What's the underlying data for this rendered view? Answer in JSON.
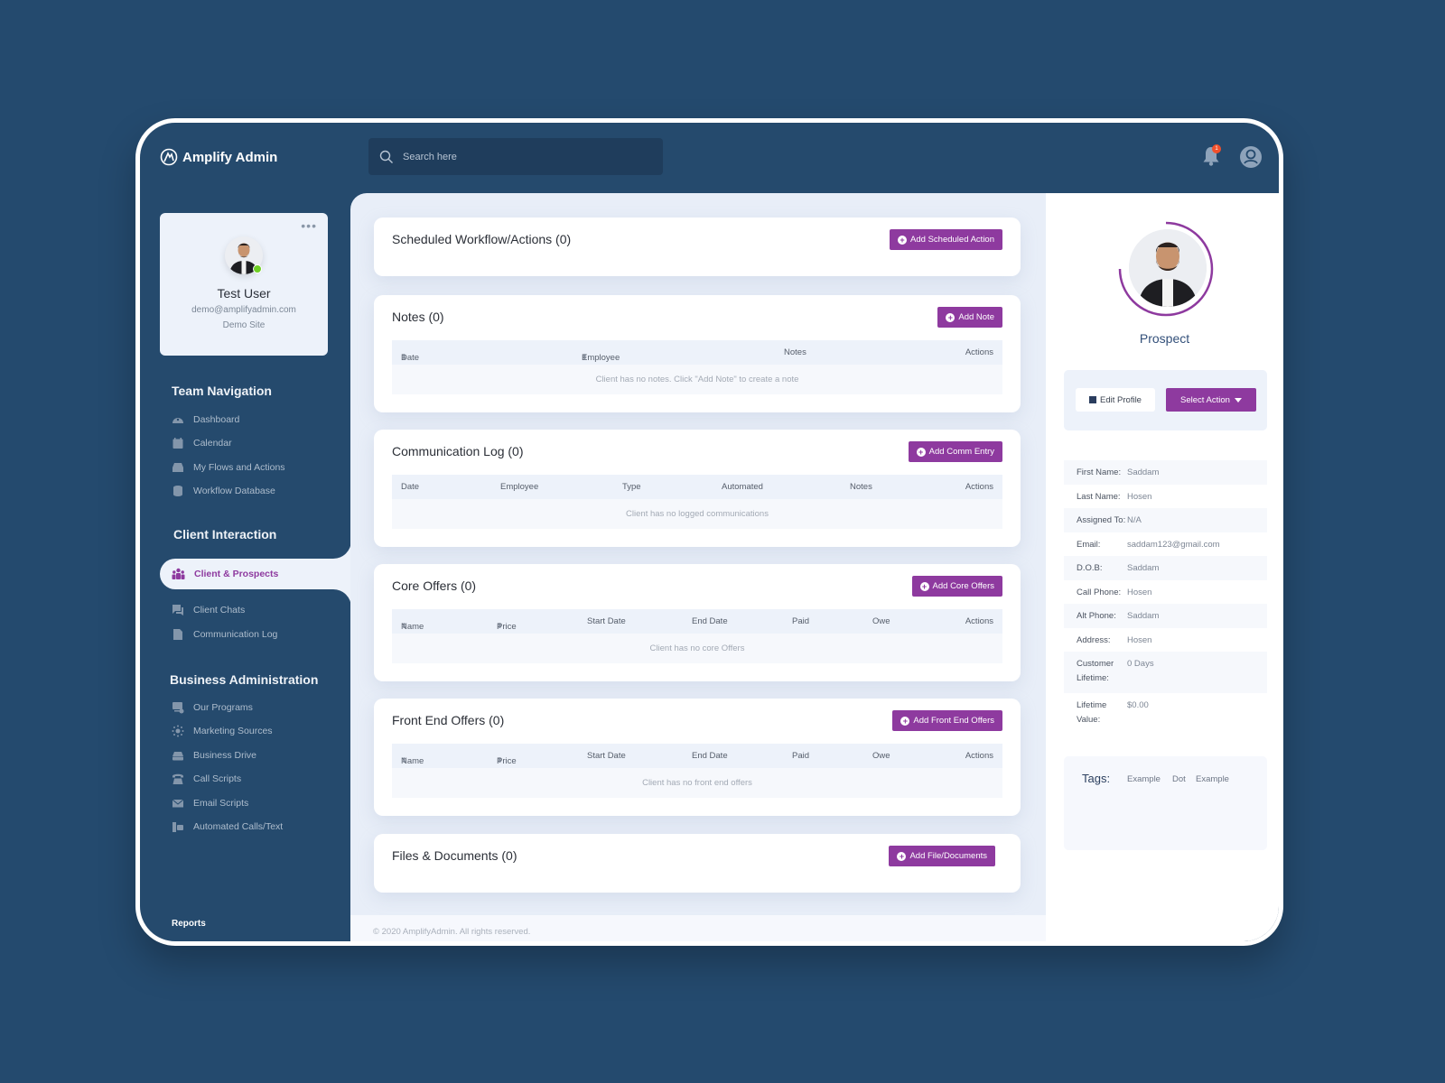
{
  "app": {
    "title": "Amplify Admin",
    "search_placeholder": "Search here",
    "notification_count": "1"
  },
  "profile": {
    "name": "Test User",
    "email": "demo@amplifyadmin.com",
    "site": "Demo Site",
    "menu_icon": "more-dots-icon"
  },
  "sidebar": {
    "sections": [
      {
        "heading": "Team Navigation",
        "items": [
          {
            "label": "Dashboard",
            "icon": "dashboard-gauge-icon"
          },
          {
            "label": "Calendar",
            "icon": "calendar-icon"
          },
          {
            "label": "My Flows and Actions",
            "icon": "inbox-tray-icon"
          },
          {
            "label": "Workflow Database",
            "icon": "database-icon"
          }
        ]
      },
      {
        "heading": "Client Interaction",
        "items": [
          {
            "label": "Client & Prospects",
            "icon": "users-group-icon",
            "active": true
          },
          {
            "label": "Client Chats",
            "icon": "chat-icon"
          },
          {
            "label": "Communication Log",
            "icon": "document-icon"
          }
        ]
      },
      {
        "heading": "Business Administration",
        "items": [
          {
            "label": "Our Programs",
            "icon": "programs-icon"
          },
          {
            "label": "Marketing Sources",
            "icon": "marketing-icon"
          },
          {
            "label": "Business Drive",
            "icon": "drive-icon"
          },
          {
            "label": "Call Scripts",
            "icon": "telephone-icon"
          },
          {
            "label": "Email Scripts",
            "icon": "envelope-icon"
          },
          {
            "label": "Automated Calls/Text",
            "icon": "automated-calls-icon"
          }
        ]
      }
    ],
    "reports_label": "Reports"
  },
  "main": {
    "cards": [
      {
        "title": "Scheduled Workflow/Actions (0)",
        "button": "Add Scheduled Action"
      },
      {
        "title": "Notes (0)",
        "button": "Add Note",
        "columns": [
          "Date",
          "Employee",
          "Notes",
          "Actions"
        ],
        "sortable": [
          true,
          true,
          false,
          false
        ],
        "empty_text": "Client has no notes. Click \"Add Note\"  to create a note"
      },
      {
        "title": "Communication Log (0)",
        "button": "Add Comm Entry",
        "columns": [
          "Date",
          "Employee",
          "Type",
          "Automated",
          "Notes",
          "Actions"
        ],
        "sortable": [
          false,
          false,
          false,
          false,
          false,
          false
        ],
        "empty_text": "Client has no logged communications"
      },
      {
        "title": "Core Offers (0)",
        "button": "Add Core Offers",
        "columns": [
          "Name",
          "Price",
          "Start Date",
          "End Date",
          "Paid",
          "Owe",
          "Actions"
        ],
        "sortable": [
          true,
          true,
          false,
          false,
          false,
          false,
          false
        ],
        "empty_text": "Client has no core Offers"
      },
      {
        "title": "Front End Offers (0)",
        "button": "Add Front End Offers",
        "columns": [
          "Name",
          "Price",
          "Start Date",
          "End Date",
          "Paid",
          "Owe",
          "Actions"
        ],
        "sortable": [
          true,
          true,
          false,
          false,
          false,
          false,
          false
        ],
        "empty_text": "Client has no front end offers"
      },
      {
        "title": "Files & Documents (0)",
        "button": "Add File/Documents"
      }
    ],
    "footer": "© 2020 AmplifyAdmin. All rights reserved."
  },
  "client": {
    "status": "Prospect",
    "edit_button": "Edit Profile",
    "select_button": "Select Action",
    "details": [
      {
        "label": "First Name:",
        "value": "Saddam"
      },
      {
        "label": "Last Name:",
        "value": "Hosen"
      },
      {
        "label": "Assigned To:",
        "value": "N/A"
      },
      {
        "label": "Email:",
        "value": "saddam123@gmail.com"
      },
      {
        "label": "D.O.B:",
        "value": "Saddam"
      },
      {
        "label": "Call Phone:",
        "value": "Hosen"
      },
      {
        "label": "Alt Phone:",
        "value": "Saddam"
      },
      {
        "label": "Address:",
        "value": "Hosen"
      },
      {
        "label": "Customer Lifetime:",
        "value": "0 Days"
      },
      {
        "label": "Lifetime Value:",
        "value": "$0.00"
      }
    ],
    "tags_label": "Tags:",
    "tags": [
      "Example",
      "Dot",
      "Example"
    ]
  },
  "colors": {
    "brand_navy": "#254a6d",
    "accent_purple": "#8e3a9f",
    "online_green": "#6fcf25",
    "notification_orange": "#f1502b"
  }
}
